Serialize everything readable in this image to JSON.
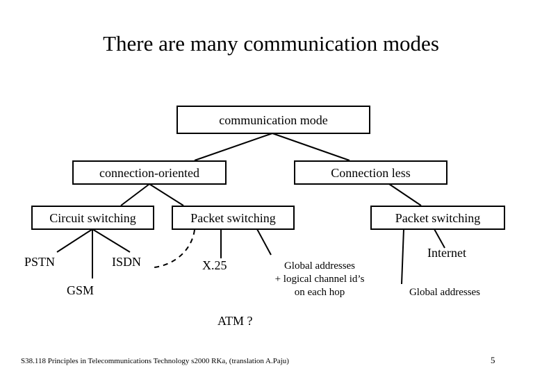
{
  "slide": {
    "title": "There are many communication modes",
    "background_color": "#ffffff",
    "text_color": "#000000",
    "line_color": "#000000"
  },
  "diagram": {
    "root": {
      "label": "communication mode"
    },
    "level2": [
      {
        "label": "connection-oriented"
      },
      {
        "label": "Connection less"
      }
    ],
    "level3": [
      {
        "label": "Circuit switching"
      },
      {
        "label": "Packet switching"
      },
      {
        "label": "Packet switching"
      }
    ],
    "leaves": [
      {
        "label": "PSTN"
      },
      {
        "label": "ISDN"
      },
      {
        "label": "GSM"
      },
      {
        "label": "X.25"
      },
      {
        "label": "ATM ?"
      },
      {
        "label": "Internet"
      }
    ],
    "annotations": [
      {
        "lines": [
          "Global addresses",
          "+ logical channel id’s",
          "on each hop"
        ]
      },
      {
        "lines": [
          "Global addresses"
        ]
      }
    ]
  },
  "footer": {
    "course": "S38.118 Principles in Telecommunications Technology s2000 RKa, (translation A.Paju)",
    "page_number": "5"
  }
}
